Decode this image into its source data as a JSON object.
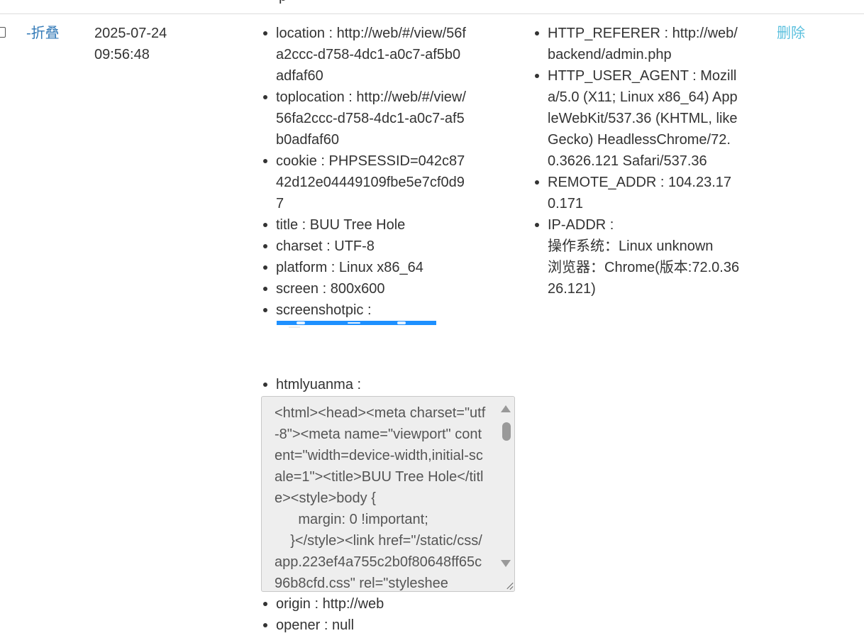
{
  "header": {
    "cut_text": "p"
  },
  "row": {
    "fold_label": "-折叠",
    "date": "2025-07-24",
    "time": "09:56:48",
    "delete_label": "删除"
  },
  "client": {
    "location": "location : http://web/#/view/56fa2ccc-d758-4dc1-a0c7-af5b0adfaf60",
    "toplocation": "toplocation : http://web/#/view/56fa2ccc-d758-4dc1-a0c7-af5b0adfaf60",
    "cookie": "cookie : PHPSESSID=042c8742d12e04449109fbe5e7cf0d97",
    "title": "title : BUU Tree Hole",
    "charset": "charset : UTF-8",
    "platform": "platform : Linux x86_64",
    "screen": "screen : 800x600",
    "screenshotpic": "screenshotpic :",
    "htmlyuanma_label": "htmlyuanma :",
    "htmlyuanma_value": "<html><head><meta charset=\"utf-8\"><meta name=\"viewport\" content=\"width=device-width,initial-scale=1\"><title>BUU Tree Hole</title><style>body {\n      margin: 0 !important;\n    }</style><link href=\"/static/css/app.223ef4a755c2b0f80648ff65c96b8cfd.css\" rel=\"styleshee",
    "origin": "origin : http://web",
    "opener": "opener : null"
  },
  "server": {
    "http_referer": "HTTP_REFERER : http://web/backend/admin.php",
    "http_user_agent": "HTTP_USER_AGENT : Mozilla/5.0 (X11; Linux x86_64) AppleWebKit/537.36 (KHTML, like Gecko) HeadlessChrome/72.0.3626.121 Safari/537.36",
    "remote_addr": "REMOTE_ADDR : 104.23.170.171",
    "ip_addr_label": "IP-ADDR :",
    "os": "操作系统：Linux unknown",
    "browser": "浏览器：Chrome(版本:72.0.3626.121)"
  },
  "icons": {
    "checkbox": "checkbox-icon",
    "scroll_up": "triangle-up-icon",
    "scroll_down": "triangle-down-icon",
    "resize": "resize-grip-icon"
  },
  "colors": {
    "link": "#337ab7",
    "delete_link": "#5bc0de",
    "screenshot_bar": "#1e90ff",
    "code_box_bg": "#eeeeee"
  }
}
